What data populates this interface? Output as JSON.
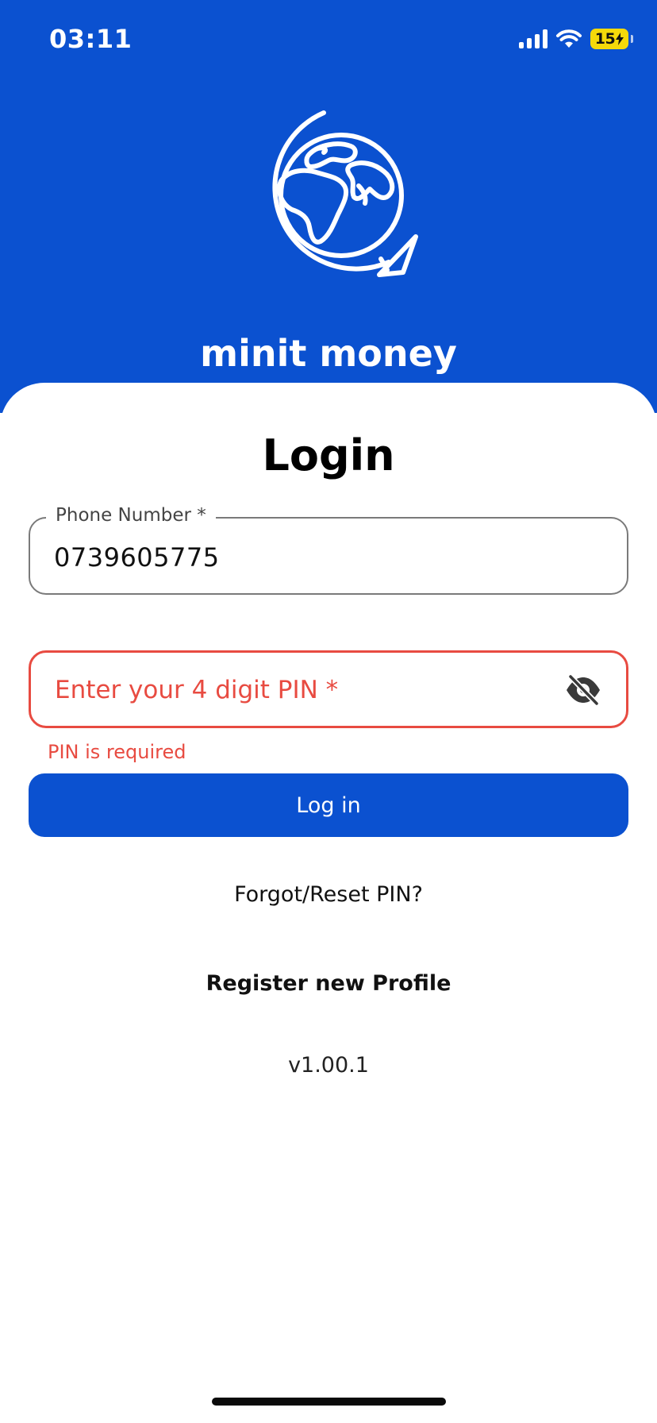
{
  "status_bar": {
    "time": "03:11",
    "battery_level": "15",
    "icons": [
      "signal-icon",
      "wifi-icon",
      "battery-charging-icon"
    ]
  },
  "brand": {
    "logo_icon": "globe-arrow-icon",
    "name": "minit money",
    "color": "#0b51d0"
  },
  "login": {
    "title": "Login",
    "phone_field": {
      "label": "Phone Number *",
      "value": "0739605775"
    },
    "pin_field": {
      "placeholder": "Enter your 4 digit PIN *",
      "error": "PIN is required",
      "toggle_icon": "eye-off-icon",
      "error_color": "#e84b41"
    },
    "login_button": "Log in",
    "forgot_link": "Forgot/Reset PIN?",
    "register_link": "Register new Profile",
    "version": "v1.00.1"
  }
}
